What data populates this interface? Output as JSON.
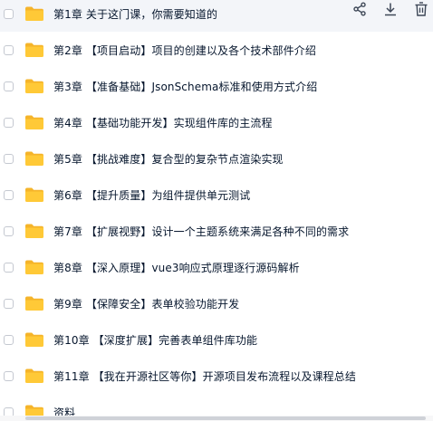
{
  "files": [
    {
      "name": "第1章 关于这门课，你需要知道的"
    },
    {
      "name": "第2章 【项目启动】项目的创建以及各个技术部件介绍"
    },
    {
      "name": "第3章 【准备基础】JsonSchema标准和使用方式介绍"
    },
    {
      "name": "第4章 【基础功能开发】实现组件库的主流程"
    },
    {
      "name": "第5章 【挑战难度】复合型的复杂节点渲染实现"
    },
    {
      "name": "第6章 【提升质量】为组件提供单元测试"
    },
    {
      "name": "第7章 【扩展视野】设计一个主题系统来满足各种不同的需求"
    },
    {
      "name": "第8章 【深入原理】vue3响应式原理逐行源码解析"
    },
    {
      "name": "第9章 【保障安全】表单校验功能开发"
    },
    {
      "name": "第10章 【深度扩展】完善表单组件库功能"
    },
    {
      "name": "第11章 【我在开源社区等你】开源项目发布流程以及课程总结"
    },
    {
      "name": "资料"
    }
  ],
  "actions": {
    "share_icon": "share-icon",
    "download_icon": "download-icon",
    "delete_icon": "trash-icon"
  },
  "colors": {
    "folder": "#ffc937",
    "folder_tab": "#f5b42a",
    "text": "#06162d",
    "icon": "#3d4757",
    "hover_row": "#f3f5f9"
  }
}
